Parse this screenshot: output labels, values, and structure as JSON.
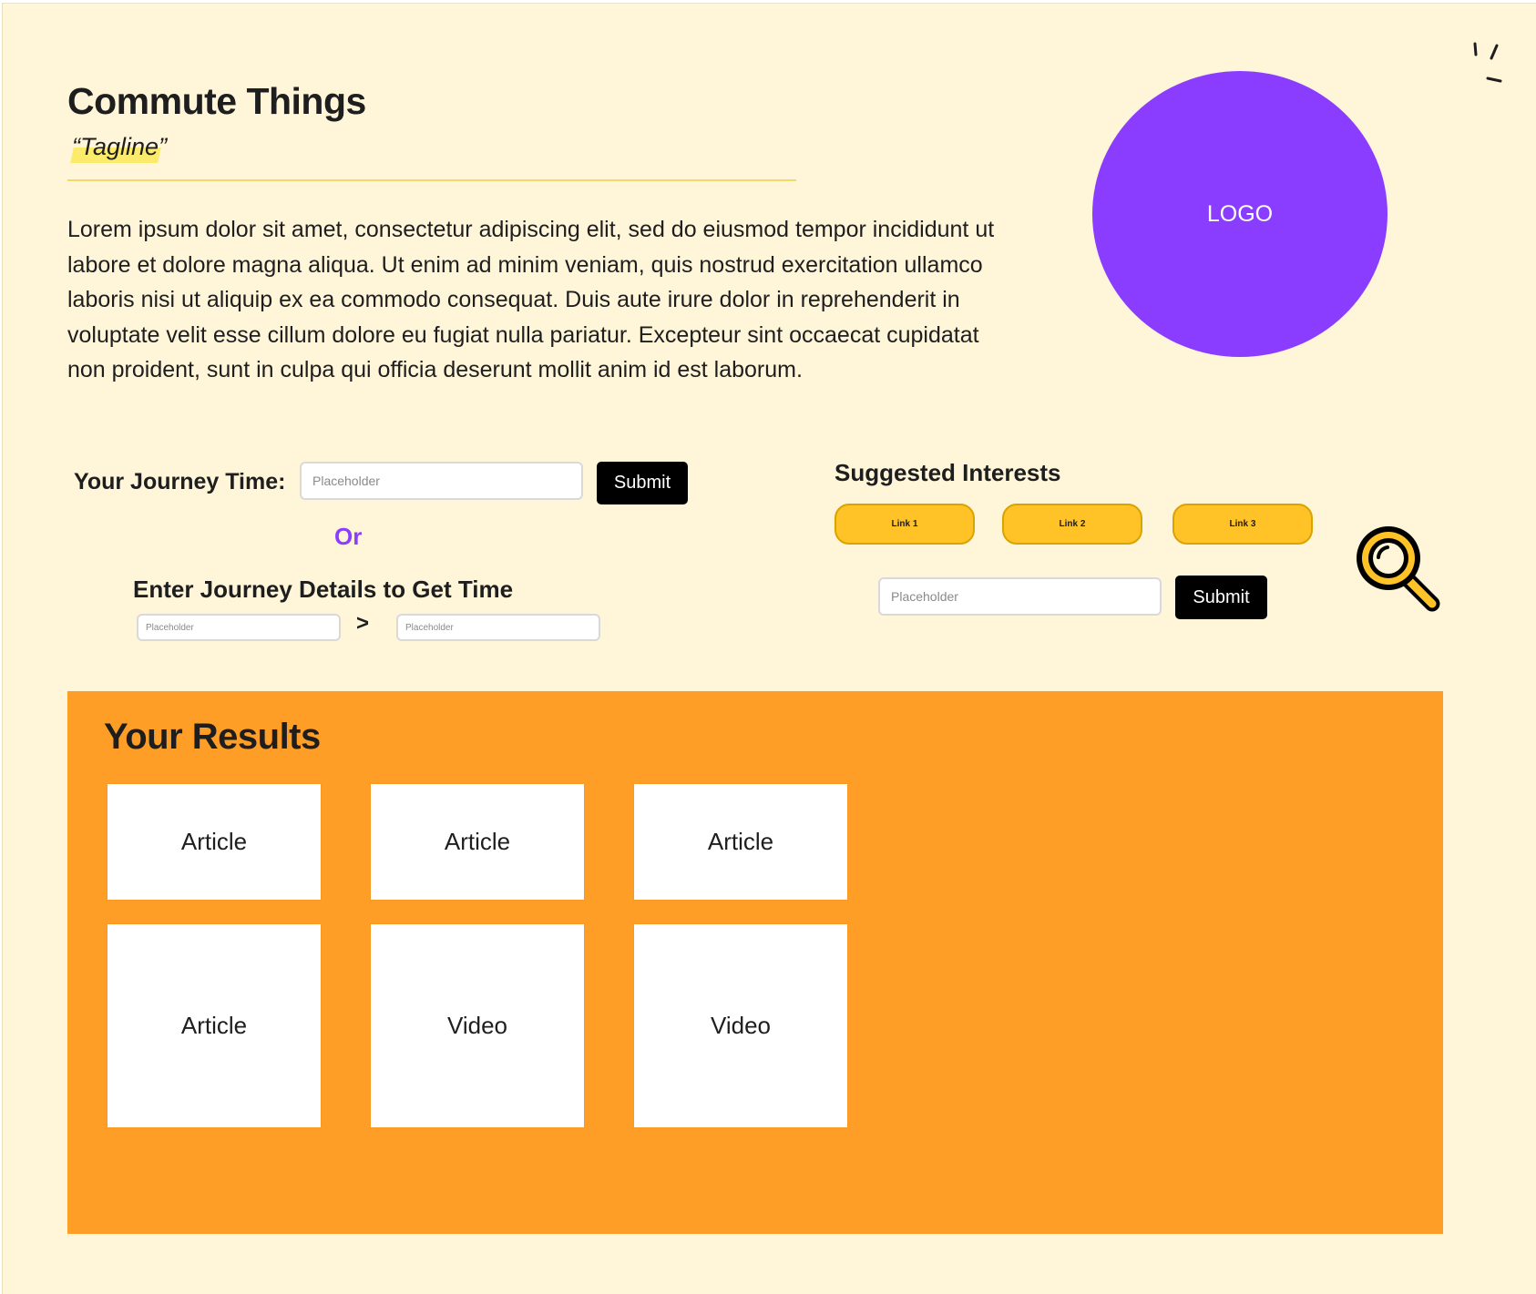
{
  "header": {
    "title": "Commute Things",
    "tagline": "“Tagline”",
    "intro": "Lorem ipsum dolor sit amet, consectetur adipiscing elit, sed do eiusmod tempor incididunt ut labore et dolore magna aliqua. Ut enim ad minim veniam, quis nostrud exercitation ullamco laboris nisi ut aliquip ex ea commodo consequat. Duis aute irure dolor in reprehenderit in voluptate velit esse cillum dolore eu fugiat nulla pariatur. Excepteur sint occaecat cupidatat non proident, sunt in culpa qui officia deserunt mollit anim id est laborum."
  },
  "logo": {
    "label": "LOGO",
    "color": "#8b3dff"
  },
  "journey": {
    "label": "Your Journey Time:",
    "input_placeholder": "Placeholder",
    "submit_label": "Submit",
    "or_label": "Or",
    "details_label": "Enter Journey Details to Get Time",
    "from_placeholder": "Placeholder",
    "separator": ">",
    "to_placeholder": "Placeholder"
  },
  "interests": {
    "title": "Suggested Interests",
    "links": [
      "Link 1",
      "Link 2",
      "Link 3"
    ],
    "search_placeholder": "Placeholder",
    "submit_label": "Submit",
    "icon": "magnifier-icon"
  },
  "results": {
    "title": "Your Results",
    "cards": [
      "Article",
      "Article",
      "Article",
      "Article",
      "Video",
      "Video"
    ]
  },
  "colors": {
    "page_background": "#fff5d9",
    "results_background": "#ff9e27",
    "link_pill": "#ffc227",
    "accent_purple": "#8b3dff",
    "button": "#000000"
  }
}
